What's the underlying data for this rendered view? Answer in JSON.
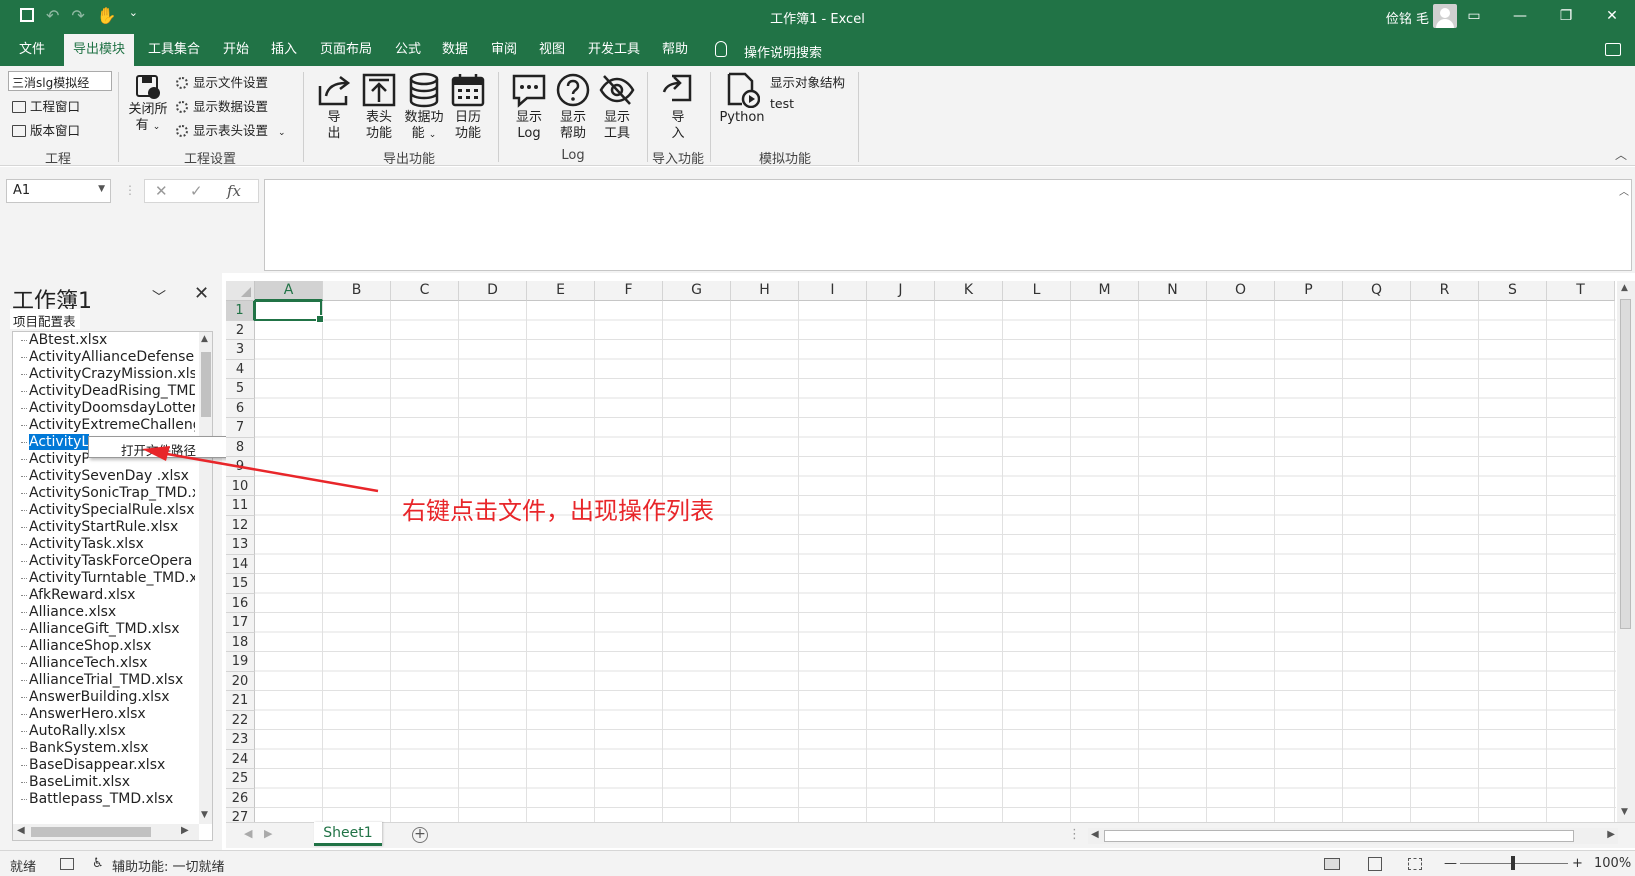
{
  "window": {
    "title": "工作簿1 - Excel",
    "user": "俭铭 毛",
    "qat_overflow": "⌄"
  },
  "menu": {
    "tabs": [
      "文件",
      "导出模块",
      "工具集合",
      "开始",
      "插入",
      "页面布局",
      "公式",
      "数据",
      "审阅",
      "视图",
      "开发工具",
      "帮助"
    ],
    "active_index": 1,
    "tell_me": "操作说明搜索"
  },
  "ribbon": {
    "project_select": "三消slg模拟经",
    "project_window": "工程窗口",
    "version_window": "版本窗口",
    "close_all_1": "关闭所",
    "close_all_2": "有",
    "show_file_settings": "显示文件设置",
    "show_data_settings": "显示数据设置",
    "show_header_settings": "显示表头设置",
    "export_1": "导",
    "export_2": "出",
    "header_func_1": "表头",
    "header_func_2": "功能",
    "data_func_1": "数据功",
    "data_func_2": "能",
    "calendar_func_1": "日历",
    "calendar_func_2": "功能",
    "show_log_1": "显示",
    "show_log_2": "Log",
    "show_help_1": "显示",
    "show_help_2": "帮助",
    "show_tools_1": "显示",
    "show_tools_2": "工具",
    "import_1": "导",
    "import_2": "入",
    "python": "Python",
    "show_object_structure": "显示对象结构",
    "test": "test",
    "groups": {
      "project": "工程",
      "project_settings": "工程设置",
      "export": "导出功能",
      "log": "Log",
      "import": "导入功能",
      "sim": "模拟功能"
    }
  },
  "formula": {
    "namebox": "A1",
    "fx": "fx",
    "cancel": "✕",
    "enter": "✓",
    "value": ""
  },
  "taskpane": {
    "title": "工作簿1",
    "tab": "项目配置表",
    "files": [
      "ABtest.xlsx",
      "ActivityAllianceDefense",
      "ActivityCrazyMission.xlsx",
      "ActivityDeadRising_TMD",
      "ActivityDoomsdayLotter",
      "ActivityExtremeChalleng",
      "ActivityLotto.xlsx",
      "ActivityP",
      "ActivitySevenDay .xlsx",
      "ActivitySonicTrap_TMD.x",
      "ActivitySpecialRule.xlsx",
      "ActivityStartRule.xlsx",
      "ActivityTask.xlsx",
      "ActivityTaskForceOpera",
      "ActivityTurntable_TMD.x",
      "AfkReward.xlsx",
      "Alliance.xlsx",
      "AllianceGift_TMD.xlsx",
      "AllianceShop.xlsx",
      "AllianceTech.xlsx",
      "AllianceTrial_TMD.xlsx",
      "AnswerBuilding.xlsx",
      "AnswerHero.xlsx",
      "AutoRally.xlsx",
      "BankSystem.xlsx",
      "BaseDisappear.xlsx",
      "BaseLimit.xlsx",
      "Battlepass_TMD.xlsx"
    ],
    "selected_index": 6,
    "selected_visible_text": "ActivityL",
    "context_menu": "打开文件路径"
  },
  "sheet": {
    "columns": [
      "A",
      "B",
      "C",
      "D",
      "E",
      "F",
      "G",
      "H",
      "I",
      "J",
      "K",
      "L",
      "M",
      "N",
      "O",
      "P",
      "Q",
      "R",
      "S",
      "T"
    ],
    "rows": [
      "1",
      "2",
      "3",
      "4",
      "5",
      "6",
      "7",
      "8",
      "9",
      "10",
      "11",
      "12",
      "13",
      "14",
      "15",
      "16",
      "17",
      "18",
      "19",
      "20",
      "21",
      "22",
      "23",
      "24",
      "25",
      "26",
      "27"
    ],
    "tab": "Sheet1",
    "add": "+"
  },
  "status": {
    "ready": "就绪",
    "accessibility": "辅助功能: 一切就绪",
    "zoom": "100%",
    "minus": "—",
    "plus": "+"
  },
  "annotation": {
    "text": "右键点击文件，出现操作列表",
    "color": "#e8262a"
  },
  "colors": {
    "excel_green": "#217346",
    "selection_blue": "#0078d7"
  }
}
